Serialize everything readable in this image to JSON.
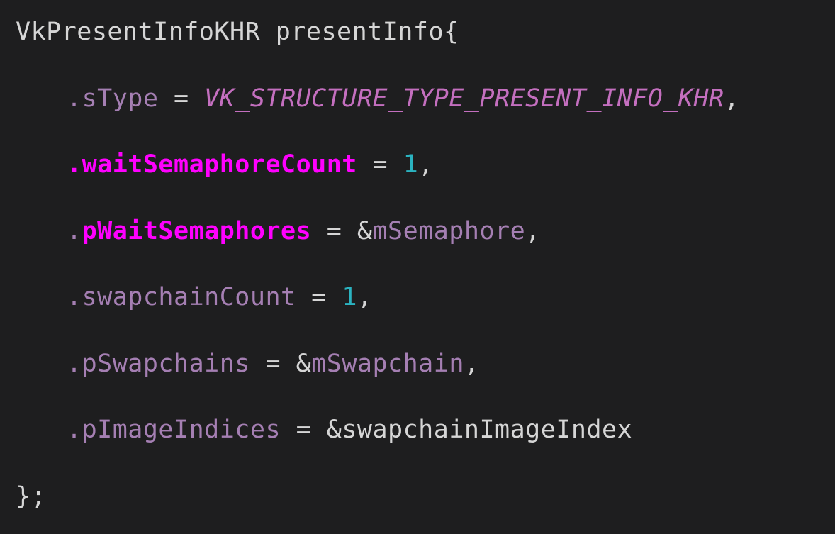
{
  "code": {
    "lines": [
      {
        "type_name": "VkPresentInfoKHR",
        "var_name": "presentInfo",
        "open": "{"
      },
      {
        "dot": ".",
        "field": "sType",
        "eq": " = ",
        "value": "VK_STRUCTURE_TYPE_PRESENT_INFO_KHR",
        "end": ","
      },
      {
        "dot": ".",
        "field": "waitSemaphoreCount",
        "eq": " = ",
        "value": "1",
        "end": ","
      },
      {
        "dot": ".",
        "field": "pWaitSemaphores",
        "eq": " = ",
        "amp": "&",
        "value": "mSemaphore",
        "end": ","
      },
      {
        "dot": ".",
        "field": "swapchainCount",
        "eq": " = ",
        "value": "1",
        "end": ","
      },
      {
        "dot": ".",
        "field": "pSwapchains",
        "eq": " = ",
        "amp": "&",
        "value": "mSwapchain",
        "end": ","
      },
      {
        "dot": ".",
        "field": "pImageIndices",
        "eq": " = ",
        "amp": "&",
        "value": "swapchainImageIndex"
      },
      {
        "close": "};"
      }
    ]
  },
  "colors": {
    "background": "#1e1e1f",
    "plain_text": "#d6d6d6",
    "field": "#a57fb3",
    "highlighted_field": "#ff00ff",
    "enum_constant": "#c46fbf",
    "number": "#2bb3c0"
  }
}
